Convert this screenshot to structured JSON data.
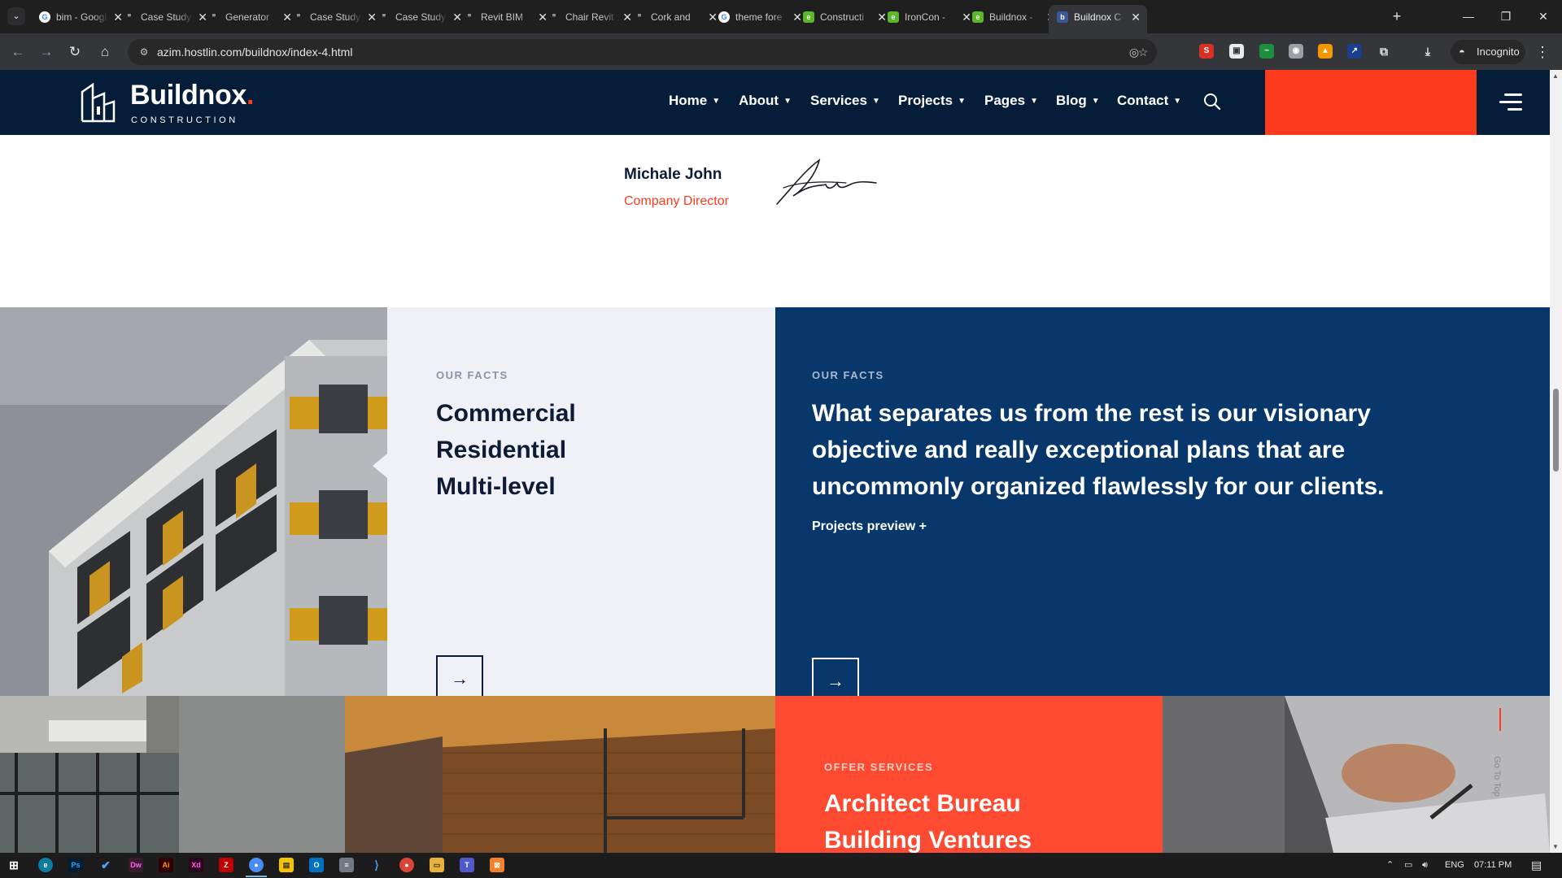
{
  "browser": {
    "tabs": [
      {
        "title": "bim - Google",
        "favicon": "google-icon"
      },
      {
        "title": "Case Study",
        "favicon": "page-icon"
      },
      {
        "title": "Generator",
        "favicon": "page-icon"
      },
      {
        "title": "Case Study",
        "favicon": "page-icon"
      },
      {
        "title": "Case Study",
        "favicon": "page-icon"
      },
      {
        "title": "Revit BIM",
        "favicon": "page-icon"
      },
      {
        "title": "Chair Revit",
        "favicon": "page-icon"
      },
      {
        "title": "Cork and",
        "favicon": "page-icon"
      },
      {
        "title": "theme fore",
        "favicon": "google-icon"
      },
      {
        "title": "Constructi",
        "favicon": "envato-icon"
      },
      {
        "title": "IronCon -",
        "favicon": "envato-icon"
      },
      {
        "title": "Buildnox -",
        "favicon": "envato-icon"
      },
      {
        "title": "Buildnox C",
        "favicon": "buildnox-icon",
        "active": true
      }
    ],
    "url": "azim.hostlin.com/buildnox/index-4.html",
    "incognito_label": "Incognito"
  },
  "site": {
    "logo": {
      "name": "Buildnox",
      "tagline": "CONSTRUCTION"
    },
    "menu": [
      {
        "label": "Home",
        "icon": "chevron-down-icon"
      },
      {
        "label": "About",
        "icon": "chevron-down-icon"
      },
      {
        "label": "Services",
        "icon": "chevron-down-icon"
      },
      {
        "label": "Projects",
        "icon": "chevron-down-icon"
      },
      {
        "label": "Pages",
        "icon": "chevron-down-icon"
      },
      {
        "label": "Blog",
        "icon": "chevron-down-icon"
      },
      {
        "label": "Contact",
        "icon": "chevron-down-icon"
      }
    ],
    "accent": "#ff3b1f",
    "navy": "#061d3a"
  },
  "testimonial": {
    "author_name": "Michale John",
    "author_role": "Company Director"
  },
  "facts_left": {
    "eyebrow": "OUR FACTS",
    "items": [
      "Commercial",
      "Residential",
      "Multi-level"
    ]
  },
  "facts_right": {
    "eyebrow": "OUR FACTS",
    "text": "What separates us from the rest is our visionary objective and really exceptional plans that are uncommonly organized flawlessly for our clients.",
    "link": "Projects preview +"
  },
  "offer": {
    "eyebrow": "OFFER SERVICES",
    "items": [
      "Architect Bureau",
      "Building Ventures"
    ]
  },
  "go_to_top": "Go To Top",
  "taskbar": {
    "language": "ENG",
    "time": "07:11 PM"
  }
}
